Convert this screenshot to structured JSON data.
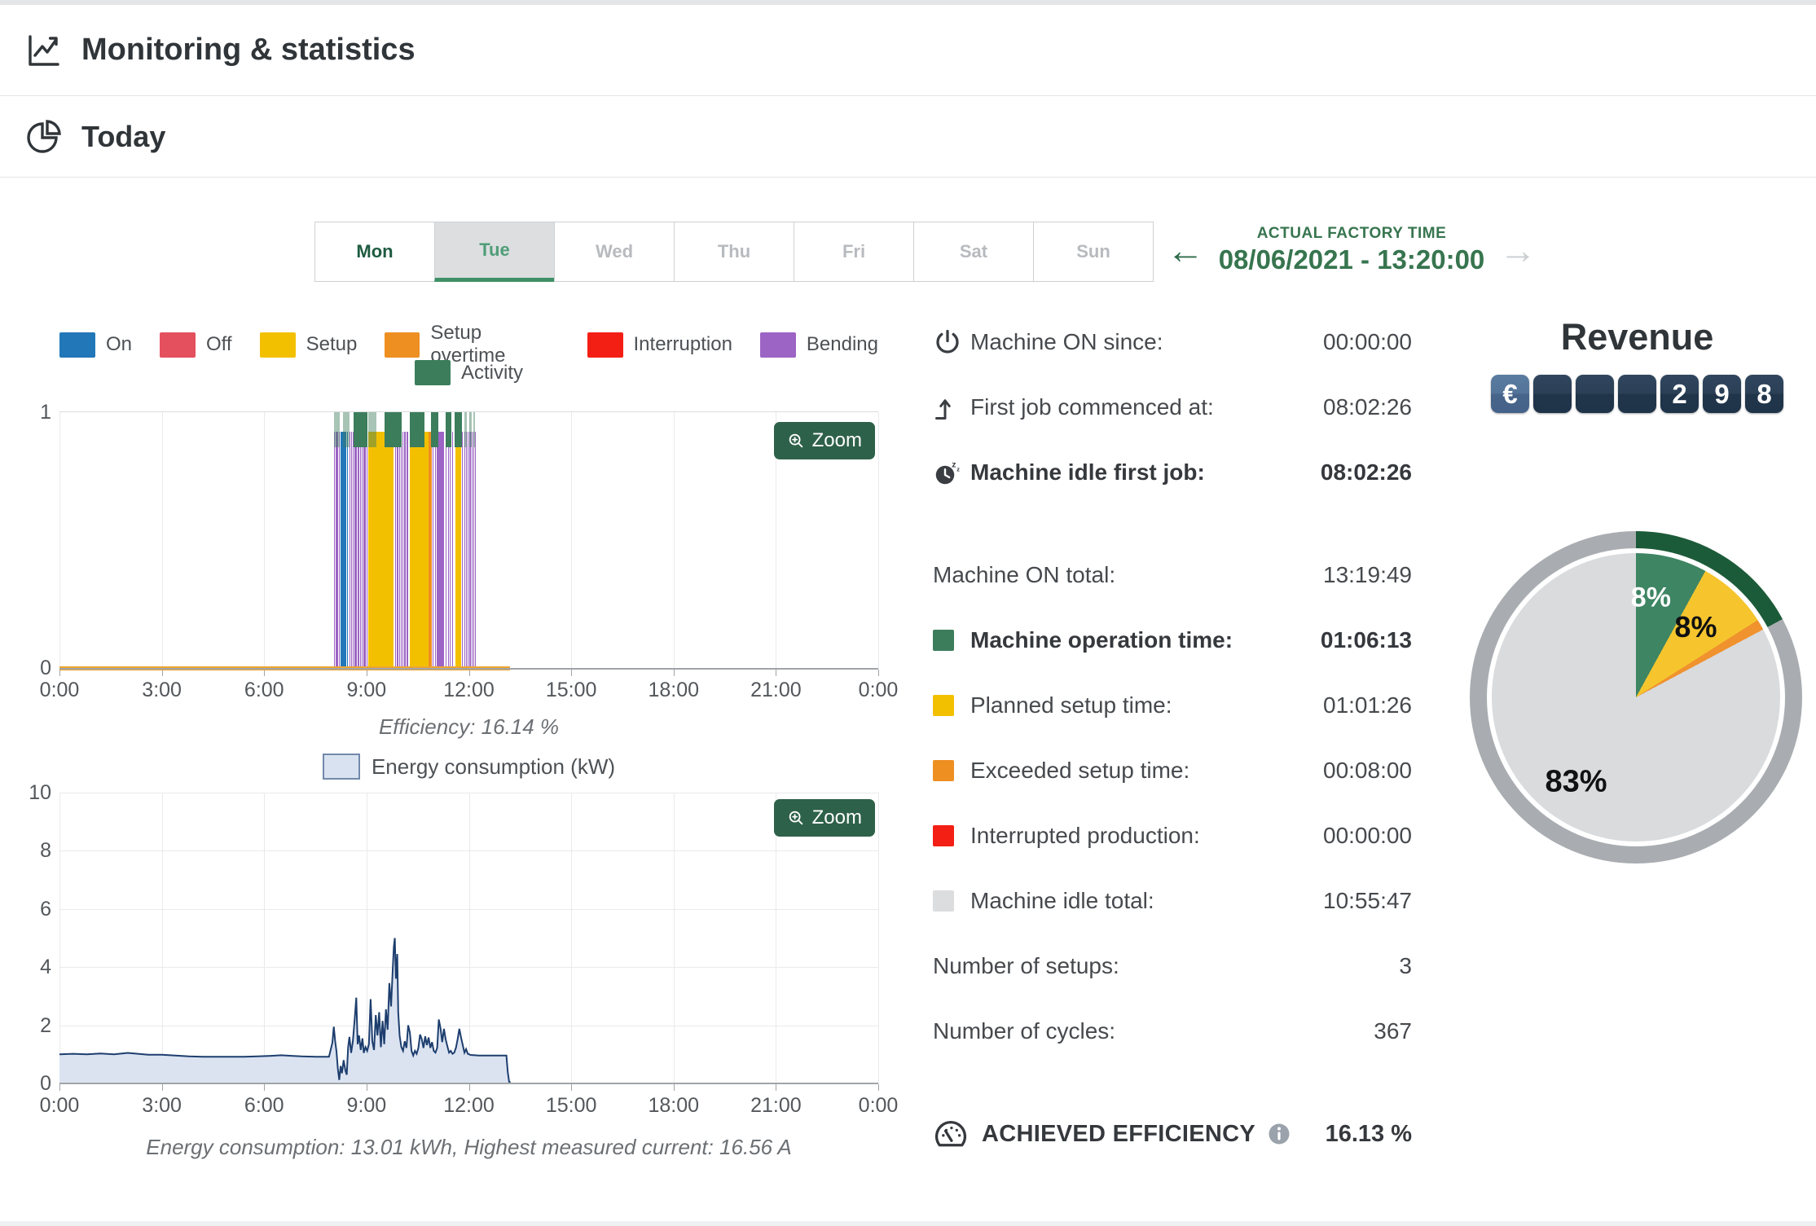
{
  "header": {
    "title": "Monitoring & statistics"
  },
  "today": {
    "title": "Today"
  },
  "week_tabs": {
    "days": [
      {
        "label": "Mon",
        "state": "today"
      },
      {
        "label": "Tue",
        "state": "selected"
      },
      {
        "label": "Wed",
        "state": "disabled"
      },
      {
        "label": "Thu",
        "state": "disabled"
      },
      {
        "label": "Fri",
        "state": "disabled"
      },
      {
        "label": "Sat",
        "state": "disabled"
      },
      {
        "label": "Sun",
        "state": "disabled"
      }
    ]
  },
  "factory_time": {
    "label": "ACTUAL FACTORY TIME",
    "value": "08/06/2021 - 13:20:00"
  },
  "accent_green": "#2e6149",
  "status_legend": [
    {
      "key": "on",
      "label": "On",
      "color": "#2277b8"
    },
    {
      "key": "off",
      "label": "Off",
      "color": "#e4505e"
    },
    {
      "key": "setup",
      "label": "Setup",
      "color": "#f3c000"
    },
    {
      "key": "overtime",
      "label": "Setup overtime",
      "color": "#ee8f22"
    },
    {
      "key": "interrupt",
      "label": "Interruption",
      "color": "#f41f14"
    },
    {
      "key": "bend",
      "label": "Bending",
      "color": "#9c64c4"
    }
  ],
  "activity_legend": {
    "key": "activity",
    "label": "Activity",
    "color": "#3c7d5c"
  },
  "timeline_chart": {
    "type": "timeline",
    "zoom_label": "Zoom",
    "y_ticks": [
      "1",
      "0"
    ],
    "x_ticks": [
      "0:00",
      "3:00",
      "6:00",
      "9:00",
      "12:00",
      "15:00",
      "18:00",
      "21:00",
      "0:00"
    ],
    "caption": "Efficiency: 16.14 %",
    "baseline_segment": {
      "start_h": 0,
      "end_h": 13.2,
      "color": "#efa42f"
    },
    "segments": [
      [
        8.04,
        8.07,
        "bend"
      ],
      [
        8.085,
        8.115,
        "bend"
      ],
      [
        8.13,
        8.16,
        "bend"
      ],
      [
        8.18,
        8.21,
        "bend"
      ],
      [
        8.23,
        8.4,
        "on"
      ],
      [
        8.43,
        8.46,
        "on"
      ],
      [
        8.49,
        8.52,
        "bend"
      ],
      [
        8.545,
        8.575,
        "bend"
      ],
      [
        8.6,
        8.63,
        "bend"
      ],
      [
        8.65,
        8.72,
        "bend"
      ],
      [
        8.74,
        8.78,
        "bend"
      ],
      [
        8.8,
        8.84,
        "bend"
      ],
      [
        8.86,
        8.895,
        "bend"
      ],
      [
        8.91,
        8.99,
        "bend"
      ],
      [
        9.0,
        9.03,
        "bend"
      ],
      [
        9.06,
        9.8,
        "setup"
      ],
      [
        9.83,
        9.86,
        "bend"
      ],
      [
        9.89,
        9.925,
        "bend"
      ],
      [
        9.95,
        9.98,
        "bend"
      ],
      [
        10.0,
        10.02,
        "bend"
      ],
      [
        10.05,
        10.08,
        "bend"
      ],
      [
        10.11,
        10.14,
        "bend"
      ],
      [
        10.17,
        10.22,
        "bend"
      ],
      [
        10.26,
        10.82,
        "setup"
      ],
      [
        10.82,
        10.92,
        "overtime"
      ],
      [
        10.94,
        10.97,
        "bend"
      ],
      [
        11.0,
        11.03,
        "bend"
      ],
      [
        11.06,
        11.28,
        "bend"
      ],
      [
        11.31,
        11.35,
        "bend"
      ],
      [
        11.38,
        11.42,
        "bend"
      ],
      [
        11.45,
        11.47,
        "bend"
      ],
      [
        11.5,
        11.52,
        "bend"
      ],
      [
        11.6,
        11.78,
        "setup"
      ],
      [
        11.8,
        11.83,
        "bend"
      ],
      [
        11.86,
        11.88,
        "bend"
      ],
      [
        11.91,
        11.93,
        "bend"
      ],
      [
        11.96,
        11.975,
        "bend"
      ],
      [
        12.0,
        12.015,
        "bend"
      ],
      [
        12.04,
        12.05,
        "bend"
      ],
      [
        12.08,
        12.09,
        "bend"
      ],
      [
        12.13,
        12.14,
        "bend"
      ],
      [
        12.18,
        12.19,
        "bend"
      ]
    ],
    "activity_segments": [
      [
        8.04,
        8.21,
        1
      ],
      [
        8.3,
        8.5,
        1
      ],
      [
        8.62,
        9.03,
        0
      ],
      [
        9.06,
        9.3,
        1
      ],
      [
        9.52,
        10.02,
        0
      ],
      [
        10.26,
        10.7,
        0
      ],
      [
        10.88,
        11.1,
        0
      ],
      [
        11.31,
        11.48,
        0
      ],
      [
        11.58,
        11.8,
        0
      ],
      [
        11.86,
        11.95,
        1
      ],
      [
        12.0,
        12.09,
        1
      ],
      [
        12.13,
        12.19,
        1
      ]
    ]
  },
  "energy_chart": {
    "type": "area",
    "legend_label": "Energy consumption (kW)",
    "zoom_label": "Zoom",
    "y_ticks": [
      10,
      8,
      6,
      4,
      2,
      0
    ],
    "ymax": 10,
    "x_ticks": [
      "0:00",
      "3:00",
      "6:00",
      "9:00",
      "12:00",
      "15:00",
      "18:00",
      "21:00",
      "0:00"
    ],
    "caption": "Energy consumption: 13.01 kWh, Highest measured current: 16.56 A",
    "fill": "#dbe3f1",
    "line": "#1d3e6e",
    "points": [
      [
        0,
        1.0
      ],
      [
        0.4,
        1.02
      ],
      [
        0.8,
        1.0
      ],
      [
        1.2,
        1.03
      ],
      [
        1.6,
        1.0
      ],
      [
        2.0,
        1.05
      ],
      [
        2.3,
        1.02
      ],
      [
        2.6,
        0.99
      ],
      [
        3.0,
        0.99
      ],
      [
        3.4,
        0.96
      ],
      [
        3.8,
        0.93
      ],
      [
        4.2,
        0.92
      ],
      [
        4.6,
        0.92
      ],
      [
        5.0,
        0.92
      ],
      [
        5.4,
        0.92
      ],
      [
        5.8,
        0.93
      ],
      [
        6.2,
        0.95
      ],
      [
        6.5,
        0.97
      ],
      [
        6.8,
        0.95
      ],
      [
        7.1,
        0.93
      ],
      [
        7.5,
        0.92
      ],
      [
        7.9,
        0.92
      ],
      [
        8.0,
        1.4
      ],
      [
        8.04,
        1.95
      ],
      [
        8.08,
        1.45
      ],
      [
        8.12,
        1.1
      ],
      [
        8.16,
        0.5
      ],
      [
        8.2,
        0.12
      ],
      [
        8.24,
        0.6
      ],
      [
        8.28,
        0.35
      ],
      [
        8.33,
        0.8
      ],
      [
        8.38,
        0.45
      ],
      [
        8.42,
        0.3
      ],
      [
        8.46,
        1.25
      ],
      [
        8.5,
        1.6
      ],
      [
        8.55,
        1.05
      ],
      [
        8.6,
        1.45
      ],
      [
        8.65,
        2.15
      ],
      [
        8.7,
        2.95
      ],
      [
        8.74,
        1.35
      ],
      [
        8.78,
        1.65
      ],
      [
        8.83,
        1.15
      ],
      [
        8.88,
        1.55
      ],
      [
        8.92,
        1.05
      ],
      [
        8.97,
        1.25
      ],
      [
        9.02,
        1.12
      ],
      [
        9.07,
        1.35
      ],
      [
        9.12,
        2.9
      ],
      [
        9.17,
        1.45
      ],
      [
        9.22,
        1.15
      ],
      [
        9.27,
        2.35
      ],
      [
        9.32,
        1.65
      ],
      [
        9.37,
        2.45
      ],
      [
        9.42,
        1.25
      ],
      [
        9.47,
        2.15
      ],
      [
        9.52,
        1.35
      ],
      [
        9.57,
        2.55
      ],
      [
        9.62,
        1.85
      ],
      [
        9.67,
        3.45
      ],
      [
        9.72,
        2.65
      ],
      [
        9.77,
        3.95
      ],
      [
        9.8,
        4.7
      ],
      [
        9.83,
        5.0
      ],
      [
        9.86,
        3.6
      ],
      [
        9.9,
        4.45
      ],
      [
        9.93,
        2.45
      ],
      [
        9.97,
        1.65
      ],
      [
        10.02,
        1.25
      ],
      [
        10.07,
        1.12
      ],
      [
        10.12,
        1.45
      ],
      [
        10.17,
        1.22
      ],
      [
        10.22,
        2.0
      ],
      [
        10.27,
        1.75
      ],
      [
        10.32,
        1.12
      ],
      [
        10.37,
        0.96
      ],
      [
        10.42,
        1.12
      ],
      [
        10.47,
        1.02
      ],
      [
        10.52,
        1.22
      ],
      [
        10.57,
        1.68
      ],
      [
        10.62,
        1.52
      ],
      [
        10.67,
        1.22
      ],
      [
        10.72,
        1.62
      ],
      [
        10.77,
        1.32
      ],
      [
        10.82,
        1.58
      ],
      [
        10.87,
        1.22
      ],
      [
        10.92,
        1.42
      ],
      [
        10.97,
        1.12
      ],
      [
        11.02,
        1.06
      ],
      [
        11.07,
        1.22
      ],
      [
        11.12,
        2.2
      ],
      [
        11.17,
        1.9
      ],
      [
        11.22,
        1.42
      ],
      [
        11.27,
        1.88
      ],
      [
        11.32,
        1.52
      ],
      [
        11.37,
        1.28
      ],
      [
        11.42,
        1.06
      ],
      [
        11.47,
        1.12
      ],
      [
        11.52,
        1.02
      ],
      [
        11.57,
        1.06
      ],
      [
        11.62,
        1.22
      ],
      [
        11.67,
        1.52
      ],
      [
        11.72,
        1.88
      ],
      [
        11.77,
        1.58
      ],
      [
        11.82,
        1.32
      ],
      [
        11.87,
        1.06
      ],
      [
        11.92,
        1.18
      ],
      [
        11.97,
        1.02
      ],
      [
        12.05,
        0.98
      ],
      [
        12.3,
        0.96
      ],
      [
        12.7,
        0.96
      ],
      [
        13.0,
        0.96
      ],
      [
        13.1,
        0.96
      ],
      [
        13.14,
        0.4
      ],
      [
        13.18,
        0.06
      ],
      [
        13.22,
        0.04
      ]
    ]
  },
  "stats": {
    "top_rows": [
      {
        "icon": "power",
        "label": "Machine ON since:",
        "value": "00:00:00",
        "bold": false
      },
      {
        "icon": "first-job",
        "label": "First job commenced at:",
        "value": "08:02:26",
        "bold": false
      },
      {
        "icon": "idle-clock",
        "label": "Machine idle first job:",
        "value": "08:02:26",
        "bold": true
      }
    ],
    "main_rows": [
      {
        "label": "Machine ON total:",
        "value": "13:19:49",
        "bold": false
      },
      {
        "swatch": "#3c7d5c",
        "label": "Machine operation time:",
        "value": "01:06:13",
        "bold": true
      },
      {
        "swatch": "#f3c000",
        "label": "Planned setup time:",
        "value": "01:01:26",
        "bold": false
      },
      {
        "swatch": "#ee8f22",
        "label": "Exceeded setup time:",
        "value": "00:08:00",
        "bold": false
      },
      {
        "swatch": "#f41f14",
        "label": "Interrupted production:",
        "value": "00:00:00",
        "bold": false
      },
      {
        "swatch": "#dcdddf",
        "label": "Machine idle total:",
        "value": "10:55:47",
        "bold": false
      },
      {
        "label": "Number of setups:",
        "value": "3",
        "bold": false
      },
      {
        "label": "Number of cycles:",
        "value": "367",
        "bold": false
      }
    ]
  },
  "achieved": {
    "label": "ACHIEVED EFFICIENCY",
    "value": "16.13 %"
  },
  "revenue": {
    "title": "Revenue",
    "currency": "€",
    "tiles": [
      "",
      "",
      "",
      "2",
      "9",
      "8"
    ]
  },
  "pie_chart": {
    "type": "pie",
    "slices": [
      {
        "label": "8%",
        "value": 8,
        "color": "#3e8563"
      },
      {
        "label": "8%",
        "value": 8,
        "color": "#f6c52e"
      },
      {
        "label": "",
        "value": 1.2,
        "color": "#f0922e"
      },
      {
        "label": "83%",
        "value": 82.8,
        "color": "#d9dbdd"
      }
    ],
    "ring_color": "#a9adb1",
    "ring_highlight": {
      "color": "#1c5b39",
      "percent": 17.2
    }
  }
}
